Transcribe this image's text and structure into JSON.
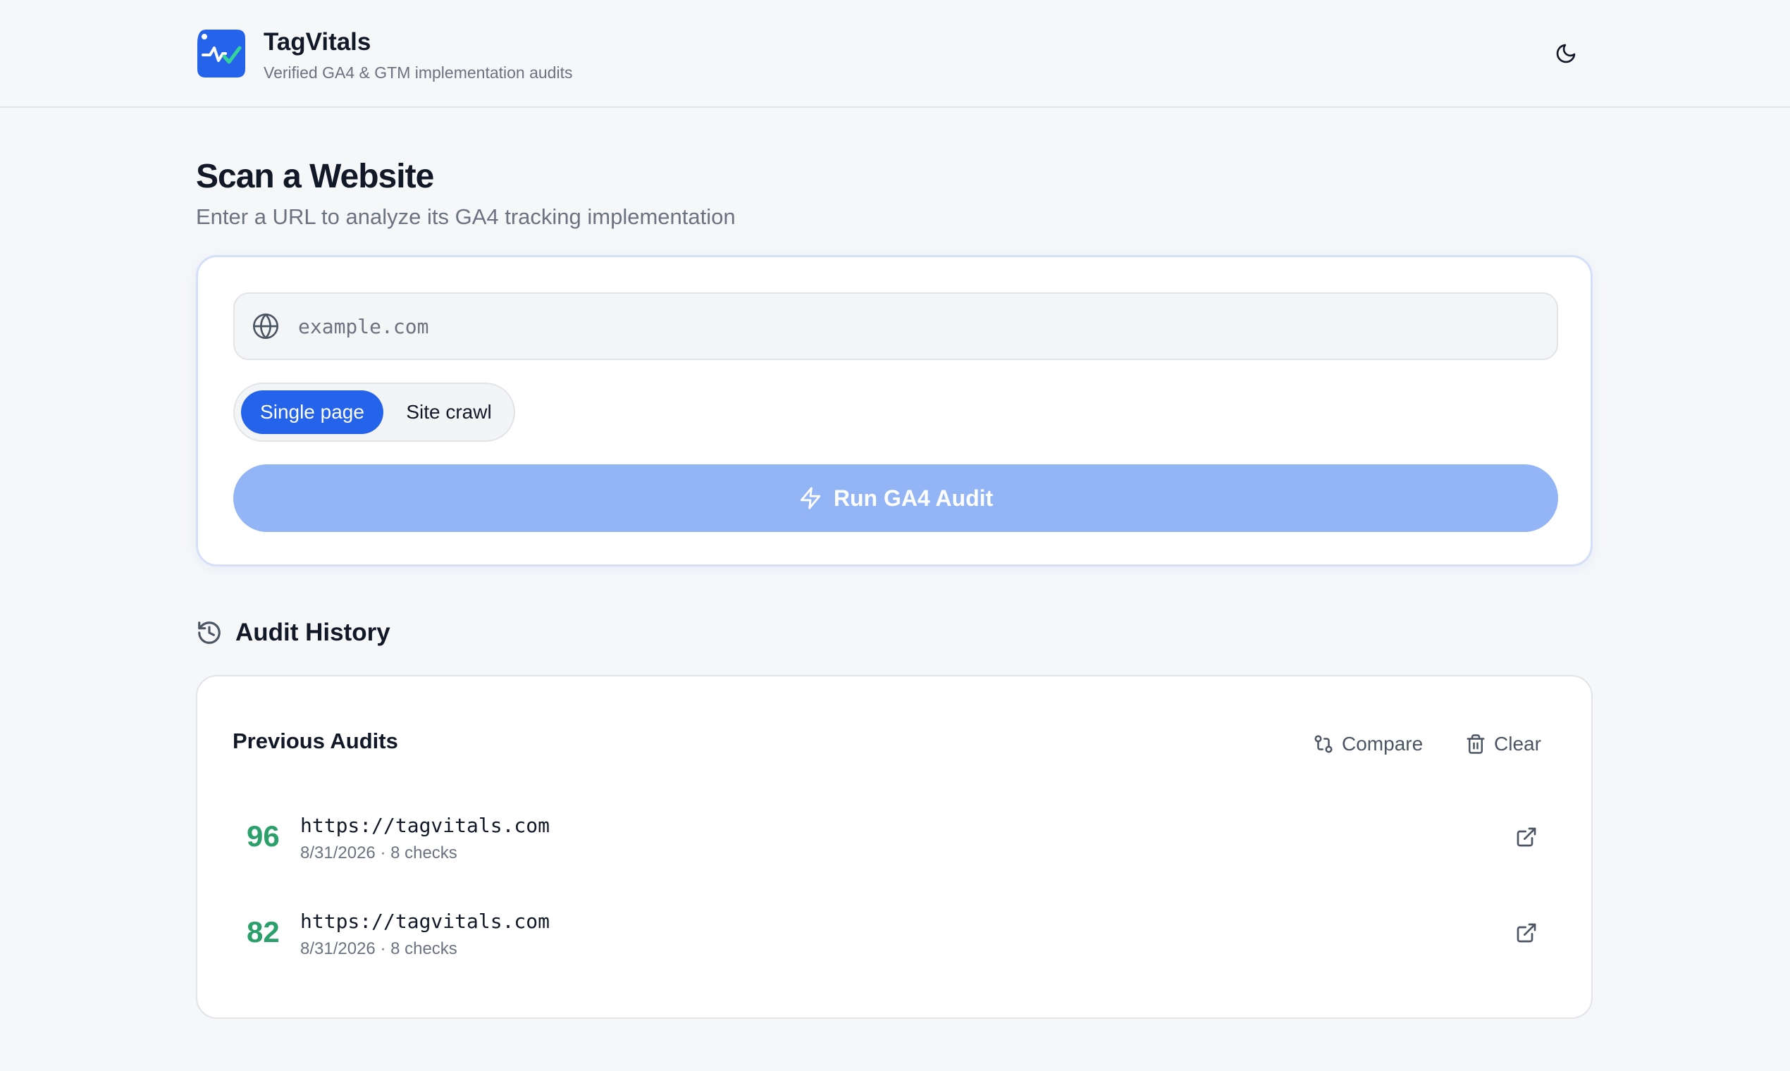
{
  "app": {
    "name": "TagVitals",
    "tagline": "Verified GA4 & GTM implementation audits",
    "accent_color": "#2563eb",
    "theme_toggle_icon": "moon-icon"
  },
  "scan": {
    "title": "Scan a Website",
    "subtitle": "Enter a URL to analyze its GA4 tracking implementation",
    "url_input": {
      "value": "",
      "placeholder": "example.com",
      "icon": "globe-icon"
    },
    "modes": [
      {
        "label": "Single page",
        "selected": true
      },
      {
        "label": "Site crawl",
        "selected": false
      }
    ],
    "run_button": {
      "label": "Run GA4 Audit",
      "icon": "bolt-icon",
      "disabled": true
    }
  },
  "history": {
    "heading": "Audit History",
    "heading_icon": "history-icon",
    "card_title": "Previous Audits",
    "compare_label": "Compare",
    "clear_label": "Clear",
    "score_color": "#2ba06a",
    "audits": [
      {
        "score": "96",
        "url": "https://tagvitals.com",
        "meta": "8/31/2026 · 8 checks"
      },
      {
        "score": "82",
        "url": "https://tagvitals.com",
        "meta": "8/31/2026 · 8 checks"
      }
    ]
  }
}
